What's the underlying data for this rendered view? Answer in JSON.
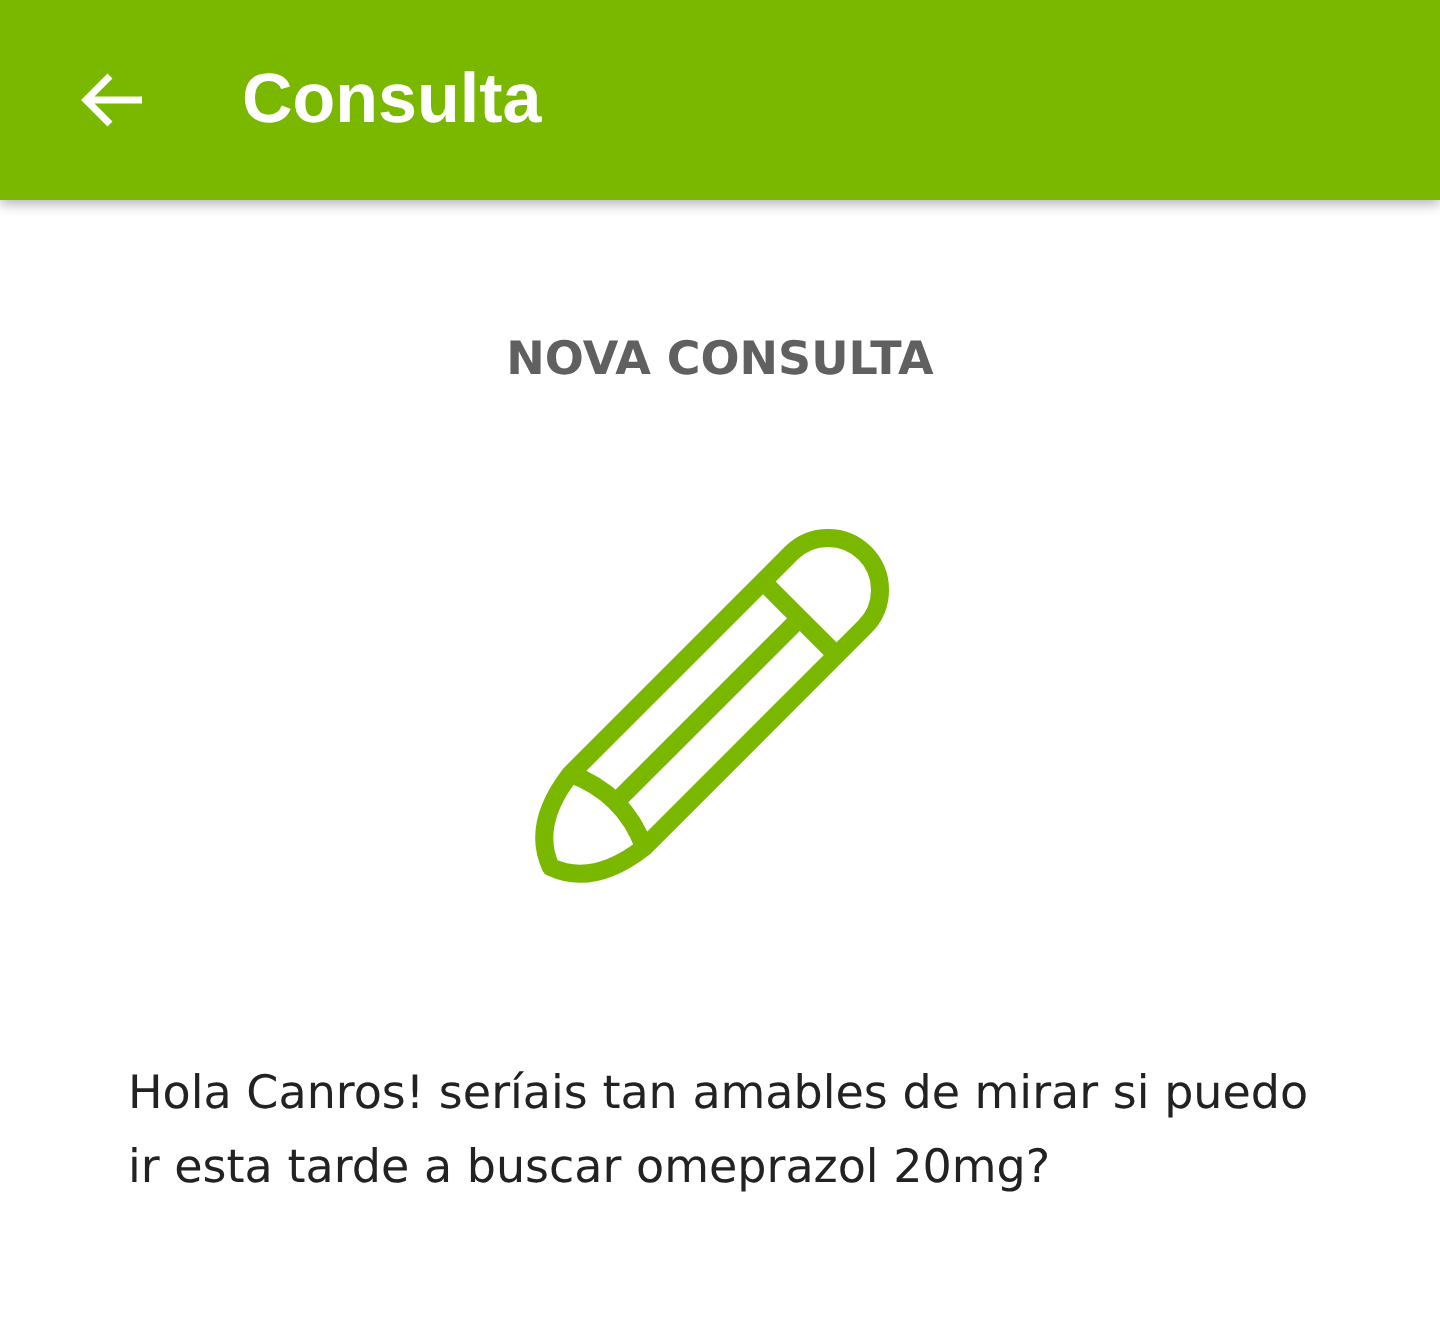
{
  "app_bar": {
    "title": "Consulta"
  },
  "heading": "NOVA CONSULTA",
  "message": "Hola Canros! seríais tan amables de mirar si puedo ir esta tarde a buscar omeprazol 20mg?"
}
